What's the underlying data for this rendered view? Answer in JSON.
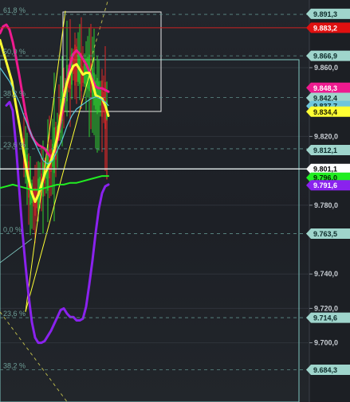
{
  "chart_data": {
    "type": "line",
    "title": "",
    "xlabel": "",
    "ylabel": "",
    "ylim": [
      9.675,
      9.903
    ],
    "grid": true,
    "price_axis": {
      "tick_values": [
        9.86,
        9.82,
        9.78,
        9.74,
        9.72,
        9.7
      ],
      "tick_labels": [
        "9.860,0",
        "9.820,0",
        "9.780,0",
        "9.740,0",
        "9.720,0",
        "9.700,0"
      ]
    },
    "fib_levels": [
      {
        "label": "61,8 %",
        "value": 9.891
      },
      {
        "label": "50,0 %",
        "value": 9.8669
      },
      {
        "label": "38,2 %",
        "value": 9.8427
      },
      {
        "label": "23,6 %",
        "value": 9.8128
      },
      {
        "label": "0,0 %",
        "value": 9.7635
      },
      {
        "label": "23,6 %",
        "value": 9.7146
      },
      {
        "label": "38,2 %",
        "value": 9.6843
      }
    ],
    "price_tags": [
      {
        "label": "9.891,3",
        "value": 9.8913,
        "bg": "#9fd5cc",
        "fg": "#0d2b2a"
      },
      {
        "label": "9.883,2",
        "value": 9.8832,
        "bg": "#e01010",
        "fg": "#ffffff"
      },
      {
        "label": "9.866,9",
        "value": 9.8669,
        "bg": "#9fd5cc",
        "fg": "#0d2b2a"
      },
      {
        "label": "9.848,3",
        "value": 9.8483,
        "bg": "#ee1a8f",
        "fg": "#ffffff"
      },
      {
        "label": "9.842,4",
        "value": 9.8424,
        "bg": "#9fd5cc",
        "fg": "#0d2b2a"
      },
      {
        "label": "9.837,7",
        "value": 9.8377,
        "bg": "#6fc6dc",
        "fg": "#0d2b2a"
      },
      {
        "label": "9.834,4",
        "value": 9.8344,
        "bg": "#ffff33",
        "fg": "#1a1a00"
      },
      {
        "label": "9.812,1",
        "value": 9.8121,
        "bg": "#9fd5cc",
        "fg": "#0d2b2a"
      },
      {
        "label": "9.801,1",
        "value": 9.8011,
        "bg": "#ffffff",
        "fg": "#000000"
      },
      {
        "label": "9.796,0",
        "value": 9.796,
        "bg": "#22ee22",
        "fg": "#002200"
      },
      {
        "label": "9.791,6",
        "value": 9.7916,
        "bg": "#8a22ee",
        "fg": "#ffffff"
      },
      {
        "label": "9.763,5",
        "value": 9.7635,
        "bg": "#9fd5cc",
        "fg": "#0d2b2a"
      },
      {
        "label": "9.714,6",
        "value": 9.7146,
        "bg": "#9fd5cc",
        "fg": "#0d2b2a"
      },
      {
        "label": "9.684,3",
        "value": 9.6843,
        "bg": "#9fd5cc",
        "fg": "#0d2b2a"
      }
    ],
    "horizontal_lines": [
      {
        "name": "red-level",
        "value": 9.8832,
        "color": "#cc2222"
      },
      {
        "name": "current-price",
        "value": 9.8011,
        "color": "#e8f0f0"
      }
    ],
    "series": [
      {
        "name": "",
        "color": "#ee1a8f",
        "points": [
          [
            0,
            9.88
          ],
          [
            4,
            9.884
          ],
          [
            8,
            9.885
          ],
          [
            12,
            9.882
          ],
          [
            16,
            9.875
          ],
          [
            20,
            9.866
          ],
          [
            24,
            9.856
          ],
          [
            28,
            9.845
          ],
          [
            32,
            9.834
          ],
          [
            36,
            9.825
          ],
          [
            40,
            9.82
          ],
          [
            44,
            9.817
          ],
          [
            48,
            9.815
          ],
          [
            52,
            9.814
          ],
          [
            56,
            9.813
          ],
          [
            60,
            9.81
          ],
          [
            64,
            9.808
          ],
          [
            68,
            9.811
          ],
          [
            72,
            9.818
          ],
          [
            76,
            9.828
          ],
          [
            80,
            9.84
          ],
          [
            84,
            9.852
          ],
          [
            88,
            9.862
          ],
          [
            92,
            9.868
          ],
          [
            96,
            9.87
          ],
          [
            100,
            9.868
          ],
          [
            104,
            9.865
          ],
          [
            108,
            9.862
          ],
          [
            112,
            9.858
          ],
          [
            116,
            9.853
          ],
          [
            120,
            9.849
          ],
          [
            124,
            9.848
          ],
          [
            128,
            9.848
          ],
          [
            132,
            9.847
          ],
          [
            136,
            9.846
          ]
        ]
      },
      {
        "name": "",
        "color": "#ffff33",
        "points": [
          [
            0,
            9.876
          ],
          [
            5,
            9.868
          ],
          [
            10,
            9.86
          ],
          [
            15,
            9.852
          ],
          [
            20,
            9.838
          ],
          [
            25,
            9.825
          ],
          [
            30,
            9.81
          ],
          [
            35,
            9.797
          ],
          [
            40,
            9.787
          ],
          [
            44,
            9.782
          ],
          [
            48,
            9.786
          ],
          [
            52,
            9.792
          ],
          [
            56,
            9.798
          ],
          [
            60,
            9.802
          ],
          [
            64,
            9.806
          ],
          [
            68,
            9.812
          ],
          [
            72,
            9.82
          ],
          [
            76,
            9.832
          ],
          [
            80,
            9.843
          ],
          [
            84,
            9.851
          ],
          [
            88,
            9.857
          ],
          [
            92,
            9.861
          ],
          [
            96,
            9.862
          ],
          [
            100,
            9.859
          ],
          [
            104,
            9.856
          ],
          [
            108,
            9.857
          ],
          [
            112,
            9.857
          ],
          [
            116,
            9.851
          ],
          [
            120,
            9.844
          ],
          [
            124,
            9.843
          ],
          [
            128,
            9.842
          ],
          [
            132,
            9.838
          ],
          [
            136,
            9.832
          ]
        ]
      },
      {
        "name": "",
        "color": "#5fc9dc",
        "points": [
          [
            0,
            9.86
          ],
          [
            6,
            9.856
          ],
          [
            12,
            9.852
          ],
          [
            18,
            9.846
          ],
          [
            24,
            9.84
          ],
          [
            30,
            9.832
          ],
          [
            36,
            9.825
          ],
          [
            42,
            9.818
          ],
          [
            48,
            9.812
          ],
          [
            54,
            9.806
          ],
          [
            60,
            9.804
          ],
          [
            66,
            9.806
          ],
          [
            72,
            9.812
          ],
          [
            78,
            9.818
          ],
          [
            84,
            9.826
          ],
          [
            90,
            9.832
          ],
          [
            96,
            9.836
          ],
          [
            102,
            9.838
          ],
          [
            108,
            9.84
          ],
          [
            114,
            9.842
          ],
          [
            120,
            9.843
          ],
          [
            126,
            9.842
          ],
          [
            132,
            9.84
          ],
          [
            136,
            9.838
          ]
        ]
      },
      {
        "name": "",
        "color": "#22ee22",
        "points": [
          [
            0,
            9.79
          ],
          [
            8,
            9.791
          ],
          [
            16,
            9.792
          ],
          [
            24,
            9.791
          ],
          [
            32,
            9.79
          ],
          [
            40,
            9.789
          ],
          [
            48,
            9.789
          ],
          [
            56,
            9.79
          ],
          [
            64,
            9.791
          ],
          [
            72,
            9.792
          ],
          [
            80,
            9.792
          ],
          [
            88,
            9.793
          ],
          [
            96,
            9.793
          ],
          [
            104,
            9.794
          ],
          [
            112,
            9.795
          ],
          [
            120,
            9.796
          ],
          [
            128,
            9.797
          ],
          [
            136,
            9.797
          ]
        ]
      },
      {
        "name": "",
        "color": "#8a22ee",
        "points": [
          [
            8,
            9.838
          ],
          [
            12,
            9.84
          ],
          [
            16,
            9.835
          ],
          [
            20,
            9.815
          ],
          [
            24,
            9.79
          ],
          [
            28,
            9.765
          ],
          [
            32,
            9.745
          ],
          [
            36,
            9.727
          ],
          [
            40,
            9.712
          ],
          [
            44,
            9.703
          ],
          [
            48,
            9.7
          ],
          [
            52,
            9.7
          ],
          [
            56,
            9.701
          ],
          [
            60,
            9.704
          ],
          [
            64,
            9.707
          ],
          [
            68,
            9.711
          ],
          [
            72,
            9.715
          ],
          [
            76,
            9.719
          ],
          [
            80,
            9.72
          ],
          [
            84,
            9.717
          ],
          [
            88,
            9.715
          ],
          [
            92,
            9.715
          ],
          [
            96,
            9.713
          ],
          [
            100,
            9.713
          ],
          [
            104,
            9.714
          ],
          [
            108,
            9.721
          ],
          [
            112,
            9.734
          ],
          [
            116,
            9.748
          ],
          [
            120,
            9.764
          ],
          [
            124,
            9.778
          ],
          [
            128,
            9.787
          ],
          [
            132,
            9.791
          ],
          [
            136,
            9.792
          ]
        ]
      }
    ],
    "trend_lines": [
      {
        "name": "",
        "color": "#ffff33",
        "from": [
          32,
          9.718
        ],
        "to": [
          118,
          9.866
        ]
      },
      {
        "name": "",
        "color": "#ffff33",
        "from": [
          32,
          9.718
        ],
        "to": [
          82,
          9.893
        ]
      },
      {
        "name": "",
        "color": "#b6b44a",
        "dashed": true,
        "from": [
          116,
          9.868
        ],
        "to": [
          139,
          9.905
        ]
      },
      {
        "name": "",
        "color": "#b6b44a",
        "dashed": true,
        "from": [
          0,
          9.718
        ],
        "to": [
          90,
          9.662
        ]
      }
    ]
  }
}
